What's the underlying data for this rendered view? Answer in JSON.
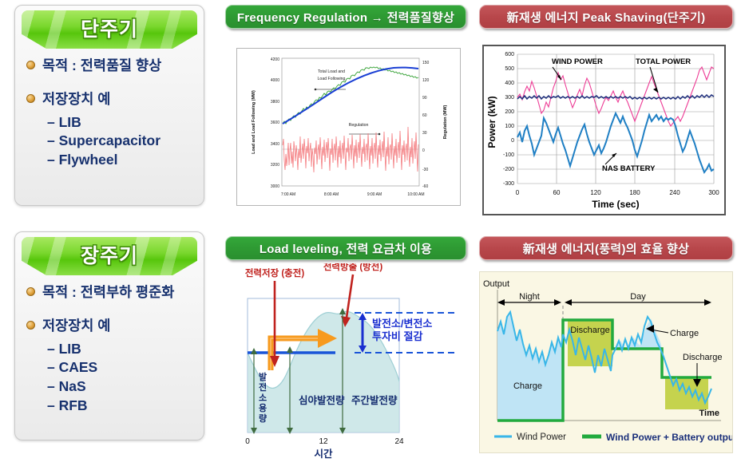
{
  "panels": {
    "short_cycle": {
      "title": "단주기",
      "bullets": [
        {
          "label": "목적 : 전력품질 향상",
          "sub": []
        },
        {
          "label": "저장장치 예",
          "sub": [
            "– LIB",
            "– Supercapacitor",
            "– Flywheel"
          ]
        }
      ]
    },
    "long_cycle": {
      "title": "장주기",
      "bullets": [
        {
          "label": "목적 : 전력부하 평준화",
          "sub": []
        },
        {
          "label": "저장장치 예",
          "sub": [
            "– LIB",
            "– CAES",
            "– NaS",
            "– RFB"
          ]
        }
      ]
    }
  },
  "headers": {
    "freq_reg": "Frequency Regulation → 전력품질향상",
    "peak_shaving": "新재생 에너지 Peak Shaving(단주기)",
    "load_leveling": "Load leveling, 전력 요금차 이용",
    "renewable_eff": "新재생 에너지(풍력)의 효율 향상"
  },
  "colors": {
    "header_green": "#2e9a33",
    "header_red": "#b8474b",
    "ribbon_green": "#79d72d",
    "text_navy": "#17316e",
    "bullet_orange": "#e0a23c",
    "load_line": "#1a3fd4",
    "load_following": "#2f9e2f",
    "regulation": "#f4787c",
    "wind_power": "#ed3d96",
    "total_power": "#1b2b7a",
    "nas_battery": "#1f7fc4",
    "wind_cyan": "#38b6e8",
    "battery_green": "#22aa3e",
    "discharge_olive": "#bcca46",
    "charge_blue": "#bfe4f5"
  },
  "chart_data": [
    {
      "id": "frequency-regulation-chart",
      "type": "line",
      "title": "",
      "annotations": [
        "Total Load and Load Following",
        "Regulation"
      ],
      "xlabel": "",
      "x_ticks": [
        "7:00 AM",
        "8:00 AM",
        "9:00 AM",
        "10:00 AM"
      ],
      "ylabel_left": "Load and Load Following (MW)",
      "y_ticks_left": [
        "3000",
        "3200",
        "3400",
        "3600",
        "3800",
        "4000",
        "4200"
      ],
      "ylim_left": [
        3000,
        4200
      ],
      "ylabel_right": "Regulation (MW)",
      "y_ticks_right": [
        "-60",
        "-30",
        "0",
        "30",
        "60",
        "90",
        "120",
        "150"
      ],
      "ylim_right": [
        -60,
        150
      ],
      "grid": false,
      "series": [
        {
          "name": "Load Following",
          "color": "#2f9e2f",
          "values": [
            3570,
            3588,
            3575,
            3600,
            3612,
            3604,
            3626,
            3640,
            3632,
            3655,
            3668,
            3660,
            3682,
            3696,
            3688,
            3712,
            3700,
            3728,
            3742,
            3735,
            3758,
            3770,
            3762,
            3784,
            3776,
            3800,
            3812,
            3804,
            3828,
            3840,
            3832,
            3856,
            3868,
            3860,
            3884,
            3896,
            3888,
            3912,
            3924,
            3916,
            3940,
            3952,
            3944,
            3968,
            3980,
            3972,
            3996,
            4008,
            4000,
            4024,
            4030,
            4022,
            4046,
            4052,
            4044,
            4058,
            4050,
            4062,
            4055,
            4068,
            4060,
            4048,
            4056,
            4044,
            4052,
            4040,
            4048,
            4036,
            4044,
            4030,
            4038,
            4026,
            4034,
            4022
          ]
        },
        {
          "name": "Total Load",
          "color": "#1a3fd4",
          "values": [
            3572,
            3588,
            3604,
            3620,
            3636,
            3652,
            3668,
            3684,
            3700,
            3716,
            3732,
            3748,
            3762,
            3776,
            3790,
            3804,
            3818,
            3832,
            3846,
            3860,
            3874,
            3886,
            3898,
            3910,
            3922,
            3934,
            3946,
            3958,
            3968,
            3978,
            3988,
            3998,
            4006,
            4014,
            4022,
            4028,
            4034,
            4040,
            4044,
            4048,
            4050,
            4052,
            4054,
            4056,
            4057,
            4058,
            4058,
            4059,
            4059,
            4060,
            4060,
            4060,
            4060,
            4060,
            4059,
            4059,
            4058,
            4058,
            4057,
            4057,
            4056,
            4056,
            4055,
            4055,
            4054,
            4054,
            4053,
            4053,
            4052,
            4052,
            4051,
            4051,
            4050,
            4050
          ]
        },
        {
          "name": "Regulation",
          "color": "#f4787c",
          "values": [
            10,
            40,
            -10,
            -25,
            20,
            -30,
            14,
            36,
            -18,
            5,
            28,
            -20,
            12,
            -28,
            40,
            8,
            -16,
            32,
            -4,
            -34,
            22,
            -10,
            44,
            -24,
            6,
            30,
            -12,
            38,
            -6,
            -30,
            16,
            -2,
            34,
            -22,
            10,
            26,
            -16,
            42,
            -8,
            -26,
            20,
            0,
            36,
            -18,
            12,
            28,
            -10,
            46,
            -30,
            8,
            24,
            -14,
            40,
            -4,
            -22,
            18,
            2,
            34,
            -26,
            10,
            30,
            -12,
            48,
            -8,
            -28,
            22,
            -2,
            38,
            -18,
            14,
            26,
            -16,
            44,
            -6,
            -24,
            20,
            4,
            32,
            -20,
            12,
            28,
            -10,
            54,
            -32,
            6,
            22,
            -14,
            42,
            -2,
            -26,
            18,
            0,
            36,
            -22,
            10,
            24,
            -12,
            46,
            -6,
            -28,
            20
          ]
        }
      ]
    },
    {
      "id": "peak-shaving-chart",
      "type": "line",
      "xlabel": "Time (sec)",
      "x_ticks": [
        "0",
        "60",
        "120",
        "180",
        "240",
        "300"
      ],
      "xlim": [
        0,
        300
      ],
      "ylabel": "Power (kW)",
      "y_ticks": [
        "-300",
        "-200",
        "-100",
        "0",
        "100",
        "200",
        "300",
        "400",
        "500",
        "600"
      ],
      "ylim": [
        -300,
        600
      ],
      "grid": true,
      "annotations": [
        "WIND POWER",
        "TOTAL POWER",
        "NAS BATTERY"
      ],
      "series": [
        {
          "name": "WIND POWER",
          "color": "#ed3d96"
        },
        {
          "name": "TOTAL POWER",
          "color": "#1b2b7a"
        },
        {
          "name": "NAS BATTERY",
          "color": "#1f7fc4"
        }
      ]
    },
    {
      "id": "load-leveling-diagram",
      "type": "area",
      "xlabel": "시간",
      "x_ticks": [
        "0",
        "12",
        "24"
      ],
      "ylabel": "발전소 용량",
      "annotations": [
        "전력저장 (충전)",
        "전력방출 (방전)",
        "발전소/변전소\n투자비 절감",
        "심야발전량",
        "주간발전량"
      ]
    },
    {
      "id": "renewable-efficiency-chart",
      "type": "area",
      "ylabel": "Output",
      "xlabel": "Time",
      "annotations": [
        "Night",
        "Day",
        "Charge",
        "Discharge",
        "Charge",
        "Discharge"
      ],
      "legend": [
        {
          "label": "Wind Power",
          "color": "#38b6e8"
        },
        {
          "label": "Wind Power + Battery output",
          "color": "#22aa3e"
        }
      ],
      "legend_position": "bottom"
    }
  ],
  "diagram_text": {
    "ll_store": "전력저장 (충전)",
    "ll_release": "전력방출 (방전)",
    "ll_savings_1": "발전소/변전소",
    "ll_savings_2": "투자비 절감",
    "ll_capacity": "발전소 용량",
    "ll_night_gen": "심야발전량",
    "ll_day_gen": "주간발전량",
    "ll_xaxis": "시간",
    "ll_tick0": "0",
    "ll_tick12": "12",
    "ll_tick24": "24",
    "re_output": "Output",
    "re_time": "Time",
    "re_night": "Night",
    "re_day": "Day",
    "re_charge1": "Charge",
    "re_discharge1": "Discharge",
    "re_charge2": "Charge",
    "re_discharge2": "Discharge",
    "re_legend1": "Wind Power",
    "re_legend2": "Wind Power + Battery output",
    "fr_ann1_l1": "Total Load and",
    "fr_ann1_l2": "Load Following",
    "fr_ann2": "Regulation",
    "fr_ylabel_l": "Load and Load Following (MW)",
    "fr_ylabel_r": "Regulation (MW)",
    "ps_wind": "WIND POWER",
    "ps_total": "TOTAL POWER",
    "ps_nas": "NAS BATTERY",
    "ps_ylabel": "Power (kW)",
    "ps_xlabel": "Time (sec)"
  }
}
